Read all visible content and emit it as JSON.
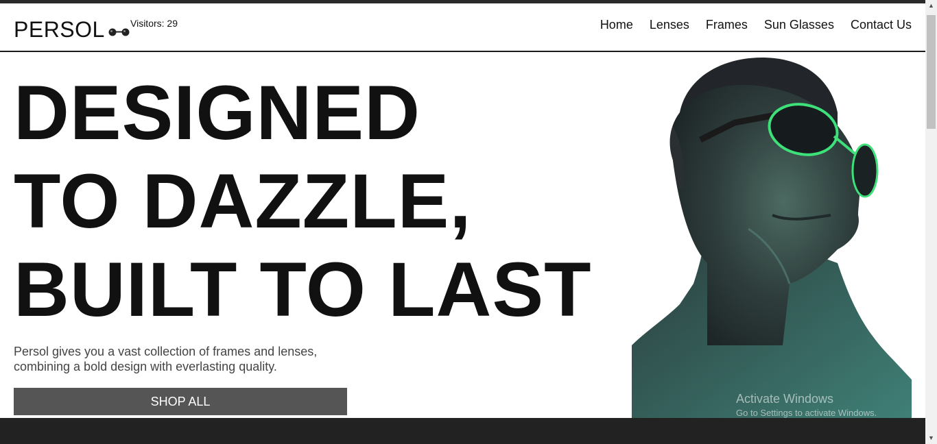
{
  "brand": {
    "name": "PERSOL",
    "logo_icon": "sunglasses-icon"
  },
  "visitors": {
    "label": "Visitors: 29"
  },
  "nav": {
    "items": [
      {
        "label": "Home"
      },
      {
        "label": "Lenses"
      },
      {
        "label": "Frames"
      },
      {
        "label": "Sun Glasses"
      },
      {
        "label": "Contact Us"
      }
    ]
  },
  "hero": {
    "title_lines": [
      "DESIGNED",
      "TO DAZZLE,",
      "BUILT TO LAST"
    ],
    "description": "Persol gives you a vast collection of frames and lenses, combining a bold design with everlasting quality.",
    "cta_label": "SHOP ALL",
    "image_icon": "model-with-sunglasses-image"
  },
  "watermark": {
    "title": "Activate Windows",
    "subtitle": "Go to Settings to activate Windows."
  },
  "colors": {
    "text": "#111111",
    "button_bg": "#555555",
    "footer_bg": "#222222",
    "lens_accent": "#3ee07a"
  }
}
